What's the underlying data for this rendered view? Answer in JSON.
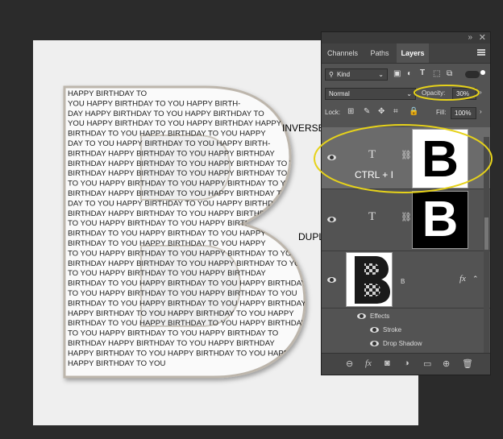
{
  "canvas": {
    "letter_lines": [
      "HAPPY BIRTHDAY TO",
      "YOU HAPPY BIRTHDAY TO YOU HAPPY BIRTH-",
      "DAY HAPPY BIRTHDAY TO YOU HAPPY BIRTHDAY TO",
      "YOU HAPPY BIRTHDAY TO YOU HAPPY BIRTHDAY HAPPY",
      "BIRTHDAY TO YOU HAPPY BIRTHDAY TO YOU HAPPY",
      "DAY TO YOU HAPPY BIRTHDAY TO YOU HAPPY BIRTH-",
      "BIRTHDAY HAPPY BIRTHDAY TO YOU HAPPY BIRTHDAY",
      "BIRTHDAY HAPPY BIRTHDAY TO YOU HAPPY BIRTHDAY TO YOU",
      "BIRTHDAY HAPPY BIRTHDAY TO YOU HAPPY BIRTHDAY TO YOU",
      "TO YOU HAPPY BIRTHDAY TO YOU HAPPY BIRTHDAY TO YOU",
      "BIRTHDAY HAPPY BIRTHDAY TO YOU HAPPY BIRTHDAY TO YOU",
      "DAY TO YOU HAPPY BIRTHDAY TO YOU HAPPY BIRTHDAY",
      "BIRTHDAY HAPPY BIRTHDAY TO YOU HAPPY BIRTHDAY",
      "TO YOU HAPPY BIRTHDAY TO YOU HAPPY BIRTHDAY TO",
      "BIRTHDAY TO YOU HAPPY BIRTHDAY TO YOU HAPPY",
      "BIRTHDAY TO YOU HAPPY BIRTHDAY TO YOU HAPPY",
      "TO YOU HAPPY BIRTHDAY TO YOU HAPPY BIRTHDAY TO YOU",
      "BIRTHDAY HAPPY BIRTHDAY TO YOU HAPPY BIRTHDAY TO YOU",
      "TO YOU HAPPY BIRTHDAY TO YOU HAPPY BIRTHDAY",
      "BIRTHDAY TO YOU HAPPY BIRTHDAY TO YOU HAPPY BIRTHDAY",
      "TO YOU HAPPY BIRTHDAY TO YOU HAPPY BIRTHDAY TO YOU",
      "BIRTHDAY TO YOU HAPPY BIRTHDAY TO YOU HAPPY BIRTHDAY",
      "HAPPY BIRTHDAY TO YOU HAPPY BIRTHDAY TO YOU HAPPY",
      "BIRTHDAY TO YOU HAPPY BIRTHDAY TO YOU HAPPY BIRTHDAY",
      "TO YOU HAPPY BIRTHDAY TO YOU HAPPY BIRTHDAY TO",
      "BIRTHDAY HAPPY BIRTHDAY TO YOU HAPPY BIRTHDAY",
      "HAPPY BIRTHDAY TO YOU HAPPY BIRTHDAY TO YOU HAPPY",
      "HAPPY BIRTHDAY TO YOU"
    ]
  },
  "annotations": {
    "inverse_mask": "INVERSE MASK",
    "ctrl_i": "CTRL + I",
    "duplicate": "DUPLICATE CTRL + J"
  },
  "panel": {
    "collapse_glyph": "»",
    "close_glyph": "✕",
    "tabs": [
      "Channels",
      "Paths",
      "Layers"
    ],
    "filter_kind": "Kind",
    "blend_mode": "Normal",
    "opacity_label": "Opacity:",
    "opacity_value": "30%",
    "lock_label": "Lock:",
    "fill_label": "Fill:",
    "fill_value": "100%",
    "layers": [
      {
        "type_glyph": "T",
        "thumb_letter": "B"
      },
      {
        "type_glyph": "T",
        "thumb_letter": "B"
      },
      {
        "name": "B",
        "thumb_letter": "B",
        "fx_label": "fx"
      }
    ],
    "effects_label": "Effects",
    "effect_items": [
      "Stroke",
      "Drop Shadow"
    ]
  },
  "colors": {
    "highlight_ellipse": "#e6d21a",
    "panel_bg": "#535353",
    "canvas_bg": "#efefef"
  }
}
